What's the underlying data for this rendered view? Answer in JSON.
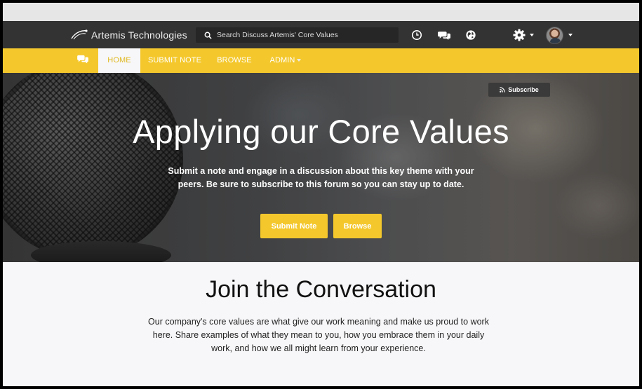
{
  "brand": {
    "name": "Artemis Technologies"
  },
  "search": {
    "placeholder": "Search Discuss Artemis' Core Values"
  },
  "topbar_icons": [
    "clock-icon",
    "chat-bubbles-icon",
    "globe-icon",
    "gear-icon"
  ],
  "nav": {
    "items": [
      {
        "label": "HOME",
        "active": true
      },
      {
        "label": "SUBMIT NOTE",
        "active": false
      },
      {
        "label": "BROWSE",
        "active": false
      },
      {
        "label": "ADMIN",
        "active": false,
        "dropdown": true
      }
    ]
  },
  "hero": {
    "subscribe_label": "Subscribe",
    "title": "Applying our Core Values",
    "subtitle": "Submit a note and engage in a discussion about this key theme with your peers. Be sure to subscribe to this forum so you can stay up to date.",
    "primary_button": "Submit Note",
    "secondary_button": "Browse"
  },
  "join": {
    "title": "Join the Conversation",
    "text": "Our company's core values are what give our work meaning and make us proud to work here. Share examples of what they mean to you, how you embrace them in your daily work, and how we all might learn from your experience."
  },
  "colors": {
    "topbar": "#333333",
    "accent": "#f4c82d",
    "page_background": "#f7f7f9"
  }
}
